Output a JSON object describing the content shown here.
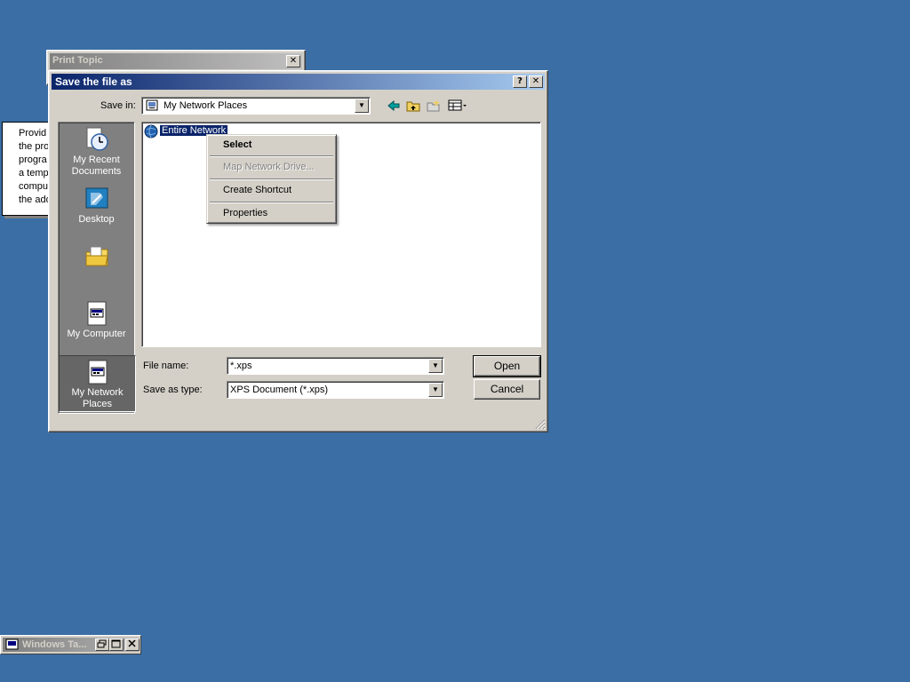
{
  "print_topic": {
    "title": "Print Topic",
    "close": "✕"
  },
  "help_note": {
    "text": "Provid\nthe pro\nprogra\na temp\ncompu\nthe add"
  },
  "dialog": {
    "title": "Save the file as",
    "help_btn": "?",
    "close_btn": "✕",
    "save_in_label": "Save in:",
    "save_in_value": "My Network Places",
    "file_name_label": "File name:",
    "file_name_value": "*.xps",
    "save_as_type_label": "Save as type:",
    "save_as_type_value": "XPS Document (*.xps)",
    "open_label": "Open",
    "cancel_label": "Cancel"
  },
  "places": [
    {
      "label": "My Recent\nDocuments",
      "icon": "recent-documents-icon"
    },
    {
      "label": "Desktop",
      "icon": "desktop-icon"
    },
    {
      "label": "",
      "icon": "my-documents-folder-icon"
    },
    {
      "label": "My Computer",
      "icon": "my-computer-icon"
    },
    {
      "label": "My Network\nPlaces",
      "icon": "network-places-icon",
      "selected": true
    }
  ],
  "file_list": {
    "items": [
      {
        "label": "Entire Network",
        "icon": "globe-icon",
        "selected": true
      }
    ]
  },
  "context_menu": {
    "items": [
      {
        "label": "Select",
        "bold": true
      },
      {
        "label": "Map Network Drive...",
        "disabled": true
      },
      {
        "label": "Create Shortcut"
      },
      {
        "label": "Properties"
      }
    ]
  },
  "task_window": {
    "title": "Windows Ta..."
  },
  "colors": {
    "desktop": "#3a6ea5",
    "active_title": "#0a246a",
    "face": "#d4d0c8"
  }
}
